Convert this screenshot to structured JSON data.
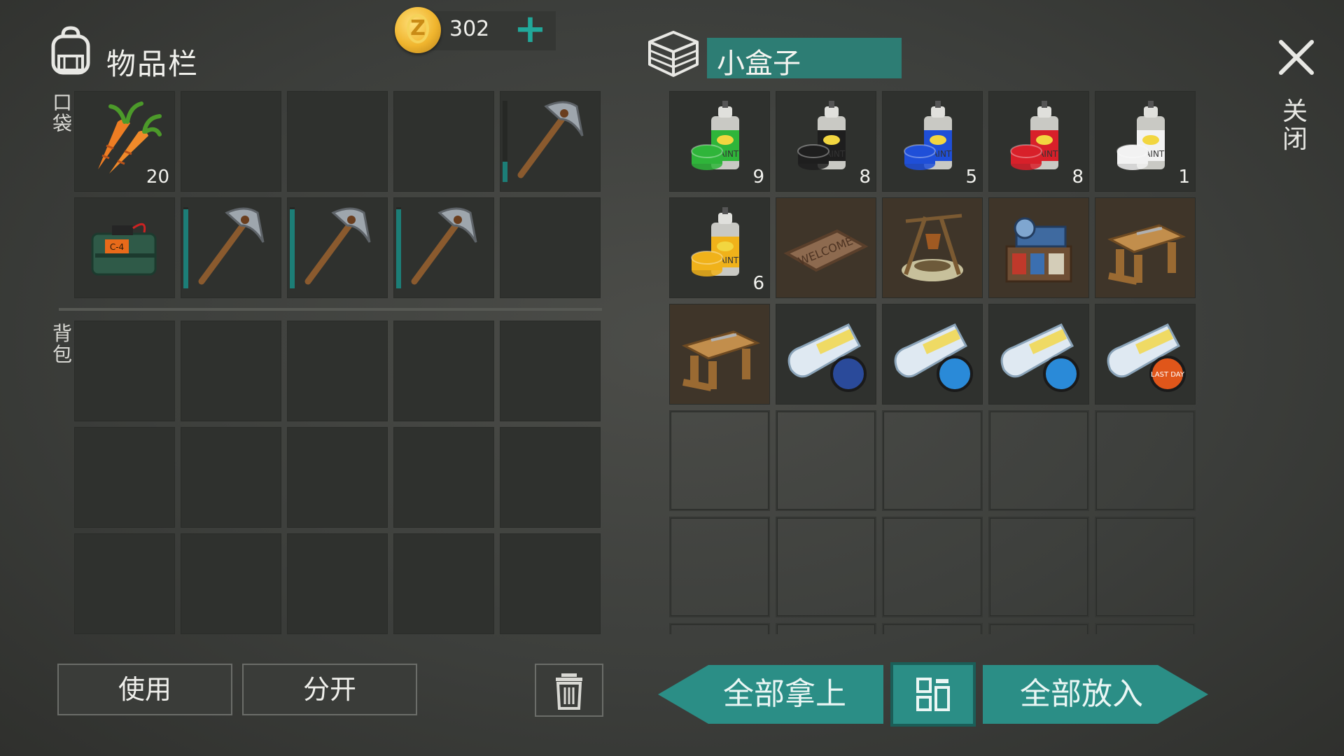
{
  "inventory": {
    "title": "物品栏",
    "pocket_label": "口袋",
    "backpack_label": "背包",
    "coins": "302",
    "pocket_slots": [
      {
        "item": "carrot-icon",
        "qty": "20"
      },
      {
        "item": "",
        "qty": ""
      },
      {
        "item": "",
        "qty": ""
      },
      {
        "item": "",
        "qty": ""
      },
      {
        "item": "pickaxe-icon",
        "qty": "",
        "durability": 0.25
      },
      {
        "item": "c4-bomb-icon",
        "qty": ""
      },
      {
        "item": "pickaxe-icon",
        "qty": "",
        "durability": 0.97
      },
      {
        "item": "pickaxe-icon",
        "qty": "",
        "durability": 0.97
      },
      {
        "item": "pickaxe-icon",
        "qty": "",
        "durability": 0.97
      },
      {
        "item": "",
        "qty": ""
      }
    ],
    "backpack_slot_count": 15
  },
  "chest": {
    "title": "小盒子",
    "slots": [
      {
        "item": "spray-paint-green-icon",
        "qty": "9",
        "color": "#2fb53a"
      },
      {
        "item": "spray-paint-black-icon",
        "qty": "8",
        "color": "#1e1e1e"
      },
      {
        "item": "spray-paint-blue-icon",
        "qty": "5",
        "color": "#1f4fd8"
      },
      {
        "item": "spray-paint-red-icon",
        "qty": "8",
        "color": "#d8202a"
      },
      {
        "item": "spray-paint-white-icon",
        "qty": "1",
        "color": "#f2f2f2"
      },
      {
        "item": "spray-paint-yellow-icon",
        "qty": "6",
        "color": "#f0b21a"
      },
      {
        "item": "welcome-mat-icon",
        "qty": "",
        "mat_text": "WELCOME"
      },
      {
        "item": "campfire-icon",
        "qty": ""
      },
      {
        "item": "workbench-machine-icon",
        "qty": ""
      },
      {
        "item": "carpentry-bench-icon",
        "qty": ""
      },
      {
        "item": "carpentry-bench-icon",
        "qty": ""
      },
      {
        "item": "blueprint-usa-icon",
        "qty": ""
      },
      {
        "item": "blueprint-blue-icon",
        "qty": ""
      },
      {
        "item": "blueprint-blue-icon",
        "qty": ""
      },
      {
        "item": "blueprint-lastday-icon",
        "qty": "",
        "badge_text": "LAST DAY"
      }
    ],
    "empty_slot_count": 15
  },
  "close_label": "关闭",
  "buttons": {
    "use": "使用",
    "split": "分开",
    "take_all": "全部拿上",
    "put_all": "全部放入"
  },
  "colors": {
    "accent_teal": "#2b8e86",
    "durability": "#1c7e77"
  }
}
